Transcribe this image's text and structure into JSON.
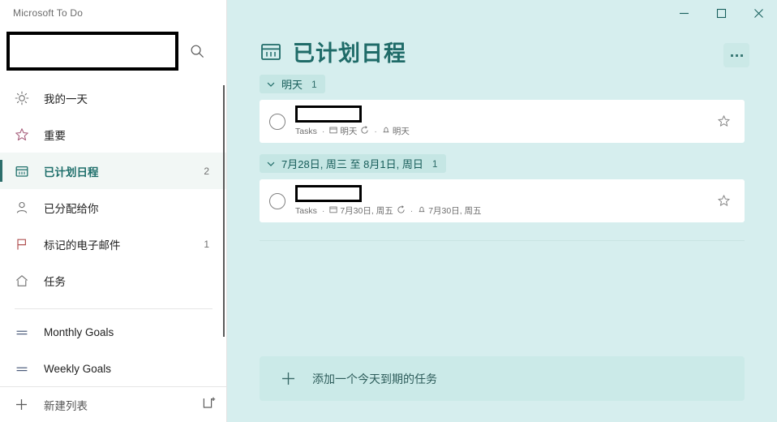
{
  "window": {
    "title": "Microsoft To Do",
    "controls": [
      {
        "name": "minimize",
        "glyph": "minimize-icon"
      },
      {
        "name": "maximize",
        "glyph": "maximize-icon"
      },
      {
        "name": "close",
        "glyph": "close-icon"
      }
    ]
  },
  "colors": {
    "accent_teal": "#1f6b68",
    "main_bg": "#d6eeee",
    "sidebar_bg": "#ffffff",
    "card_bg": "#ffffff",
    "group_chip_bg": "#c5e6e4",
    "add_task_bg": "#cbeae8",
    "selected_nav_bg": "#f2f7f5",
    "star_gray": "#8a8a8a"
  },
  "sidebar": {
    "search": {
      "placeholder": "",
      "value": "",
      "icon": "search-icon"
    },
    "items": [
      {
        "label": "我的一天",
        "icon": "sun-icon",
        "count": "",
        "selected": false
      },
      {
        "label": "重要",
        "icon": "star-icon",
        "count": "",
        "selected": false
      },
      {
        "label": "已计划日程",
        "icon": "calendar-icon",
        "count": "2",
        "selected": true
      },
      {
        "label": "已分配给你",
        "icon": "person-icon",
        "count": "",
        "selected": false
      },
      {
        "label": "标记的电子邮件",
        "icon": "flag-icon",
        "count": "1",
        "selected": false
      },
      {
        "label": "任务",
        "icon": "home-icon",
        "count": "",
        "selected": false
      }
    ],
    "lists": [
      {
        "label": "Monthly Goals",
        "icon": "list-icon",
        "count": ""
      },
      {
        "label": "Weekly Goals",
        "icon": "list-icon",
        "count": ""
      }
    ],
    "new_list": {
      "label": "新建列表",
      "icon": "plus-icon",
      "new_group_icon": "new-group-icon"
    }
  },
  "main": {
    "header": {
      "title": "已计划日程",
      "icon": "calendar-icon",
      "more_label": "..."
    },
    "groups": [
      {
        "title": "明天",
        "count": "1",
        "expanded": true,
        "tasks": [
          {
            "title": "",
            "title_redacted": true,
            "list_name": "Tasks",
            "due_label": "明天",
            "due_icon": "calendar-icon",
            "repeat_icon": "repeat-icon",
            "reminder_label": "明天",
            "reminder_icon": "bell-icon",
            "star_icon": "star-icon",
            "checkbox_icon": "circle-unchecked-icon"
          }
        ]
      },
      {
        "title": "7月28日, 周三 至 8月1日, 周日",
        "count": "1",
        "expanded": true,
        "tasks": [
          {
            "title": "",
            "title_redacted": true,
            "list_name": "Tasks",
            "due_label": "7月30日, 周五",
            "due_icon": "calendar-icon",
            "repeat_icon": "repeat-icon",
            "reminder_label": "7月30日, 周五",
            "reminder_icon": "bell-icon",
            "star_icon": "star-icon",
            "checkbox_icon": "circle-unchecked-icon"
          }
        ]
      }
    ],
    "add_task": {
      "label": "添加一个今天到期的任务",
      "icon": "plus-icon"
    }
  }
}
